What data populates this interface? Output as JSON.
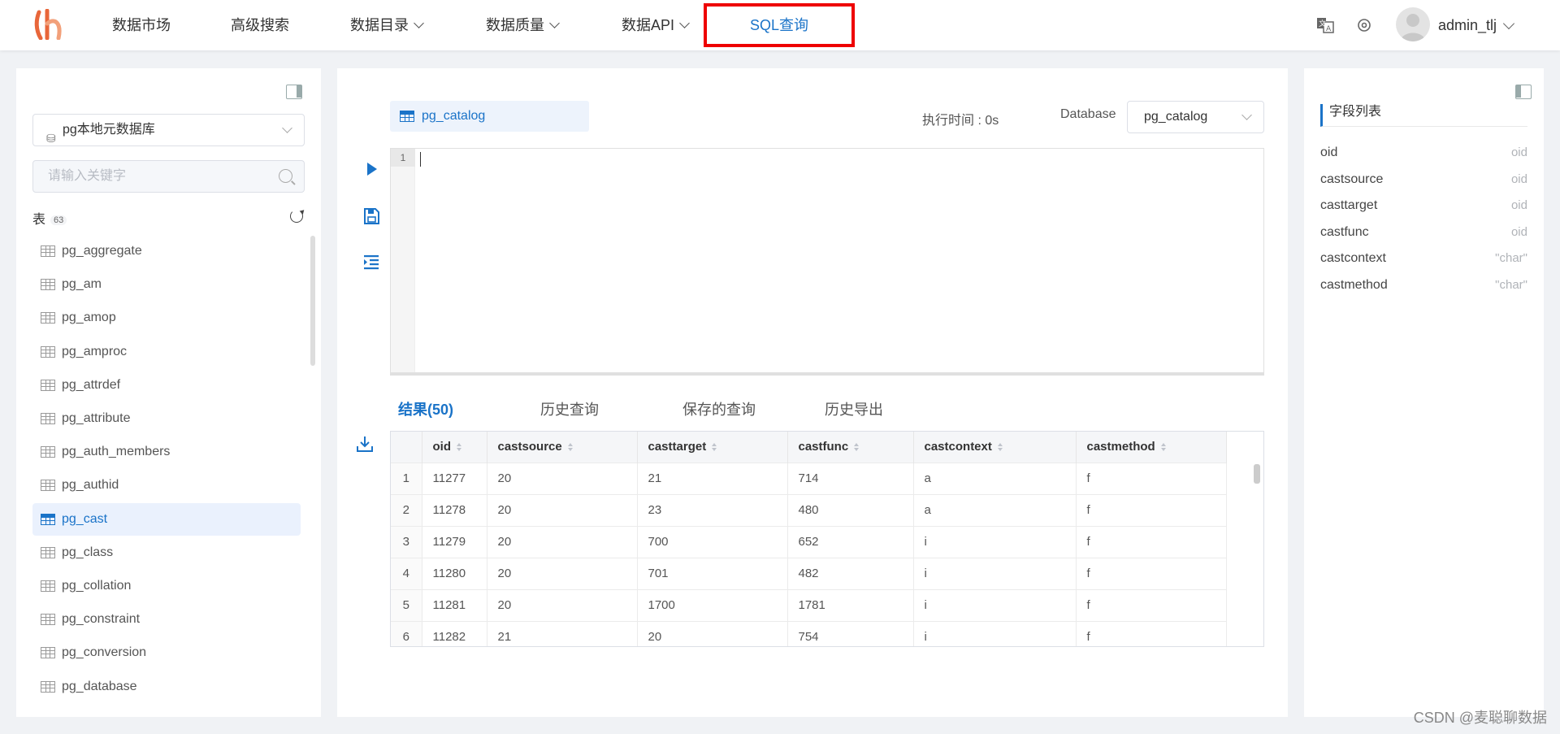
{
  "nav": {
    "items": [
      {
        "label": "数据市场",
        "dropdown": false
      },
      {
        "label": "高级搜索",
        "dropdown": false
      },
      {
        "label": "数据目录",
        "dropdown": true
      },
      {
        "label": "数据质量",
        "dropdown": true
      },
      {
        "label": "数据API",
        "dropdown": true
      }
    ],
    "active": "SQL查询",
    "username": "admin_tlj"
  },
  "left": {
    "datasource": "pg本地元数据库",
    "search_placeholder": "请输入关键字",
    "tables_label": "表",
    "tables_count": "63",
    "tables": [
      "pg_aggregate",
      "pg_am",
      "pg_amop",
      "pg_amproc",
      "pg_attrdef",
      "pg_attribute",
      "pg_auth_members",
      "pg_authid",
      "pg_cast",
      "pg_class",
      "pg_collation",
      "pg_constraint",
      "pg_conversion",
      "pg_database"
    ],
    "selected_table": "pg_cast"
  },
  "editor": {
    "tab_name": "pg_catalog",
    "exec_time": "执行时间 : 0s",
    "database_label": "Database",
    "database_value": "pg_catalog",
    "line_number": "1"
  },
  "results": {
    "tabs": [
      "结果(50)",
      "历史查询",
      "保存的查询",
      "历史导出"
    ],
    "columns": [
      "oid",
      "castsource",
      "casttarget",
      "castfunc",
      "castcontext",
      "castmethod"
    ],
    "rows": [
      [
        "1",
        "11277",
        "20",
        "21",
        "714",
        "a",
        "f"
      ],
      [
        "2",
        "11278",
        "20",
        "23",
        "480",
        "a",
        "f"
      ],
      [
        "3",
        "11279",
        "20",
        "700",
        "652",
        "i",
        "f"
      ],
      [
        "4",
        "11280",
        "20",
        "701",
        "482",
        "i",
        "f"
      ],
      [
        "5",
        "11281",
        "20",
        "1700",
        "1781",
        "i",
        "f"
      ],
      [
        "6",
        "11282",
        "21",
        "20",
        "754",
        "i",
        "f"
      ]
    ]
  },
  "right": {
    "title": "字段列表",
    "fields": [
      {
        "name": "oid",
        "type": "oid"
      },
      {
        "name": "castsource",
        "type": "oid"
      },
      {
        "name": "casttarget",
        "type": "oid"
      },
      {
        "name": "castfunc",
        "type": "oid"
      },
      {
        "name": "castcontext",
        "type": "\"char\""
      },
      {
        "name": "castmethod",
        "type": "\"char\""
      }
    ]
  },
  "watermark": "CSDN @麦聪聊数据",
  "colors": {
    "accent": "#1a73c8",
    "highlight_border": "#ee0000",
    "logo": "#e8663a"
  }
}
